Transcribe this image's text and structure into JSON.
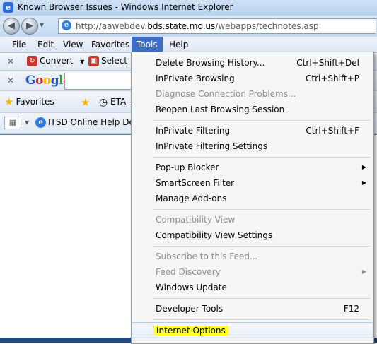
{
  "window": {
    "title": "Known Browser Issues - Windows Internet Explorer"
  },
  "address": {
    "url_prefix": "http://aawebdev.",
    "url_domain": "bds.state.mo.us",
    "url_path": "/webapps/technotes.asp"
  },
  "menubar": {
    "items": [
      {
        "label": "File"
      },
      {
        "label": "Edit"
      },
      {
        "label": "View"
      },
      {
        "label": "Favorites"
      },
      {
        "label": "Tools"
      },
      {
        "label": "Help"
      }
    ]
  },
  "toolbar1": {
    "convert_label": "Convert",
    "select_label": "Select"
  },
  "toolbar2": {
    "logo_letters": [
      "G",
      "o",
      "o",
      "g",
      "l",
      "e"
    ],
    "logo_colors": [
      "#1a55d4",
      "#d62d20",
      "#f0b400",
      "#1a55d4",
      "#2e9e3e",
      "#d62d20"
    ]
  },
  "toolbar3": {
    "favorites_label": "Favorites",
    "eta_label": "ETA -"
  },
  "toolbar4": {
    "tab_label": "ITSD Online Help Desk"
  },
  "tools_menu": {
    "groups": [
      [
        {
          "label": "Delete Browsing History...",
          "shortcut": "Ctrl+Shift+Del",
          "enabled": true
        },
        {
          "label": "InPrivate Browsing",
          "shortcut": "Ctrl+Shift+P",
          "enabled": true
        },
        {
          "label": "Diagnose Connection Problems...",
          "shortcut": "",
          "enabled": false
        },
        {
          "label": "Reopen Last Browsing Session",
          "shortcut": "",
          "enabled": true
        }
      ],
      [
        {
          "label": "InPrivate Filtering",
          "shortcut": "Ctrl+Shift+F",
          "enabled": true
        },
        {
          "label": "InPrivate Filtering Settings",
          "shortcut": "",
          "enabled": true
        }
      ],
      [
        {
          "label": "Pop-up Blocker",
          "shortcut": "",
          "enabled": true,
          "submenu": true
        },
        {
          "label": "SmartScreen Filter",
          "shortcut": "",
          "enabled": true,
          "submenu": true
        },
        {
          "label": "Manage Add-ons",
          "shortcut": "",
          "enabled": true
        }
      ],
      [
        {
          "label": "Compatibility View",
          "shortcut": "",
          "enabled": false
        },
        {
          "label": "Compatibility View Settings",
          "shortcut": "",
          "enabled": true
        }
      ],
      [
        {
          "label": "Subscribe to this Feed...",
          "shortcut": "",
          "enabled": false
        },
        {
          "label": "Feed Discovery",
          "shortcut": "",
          "enabled": false,
          "submenu": true
        },
        {
          "label": "Windows Update",
          "shortcut": "",
          "enabled": true
        }
      ],
      [
        {
          "label": "Developer Tools",
          "shortcut": "F12",
          "enabled": true
        }
      ],
      [
        {
          "label": "Internet Options",
          "shortcut": "",
          "enabled": true,
          "highlighted": true
        }
      ]
    ]
  }
}
